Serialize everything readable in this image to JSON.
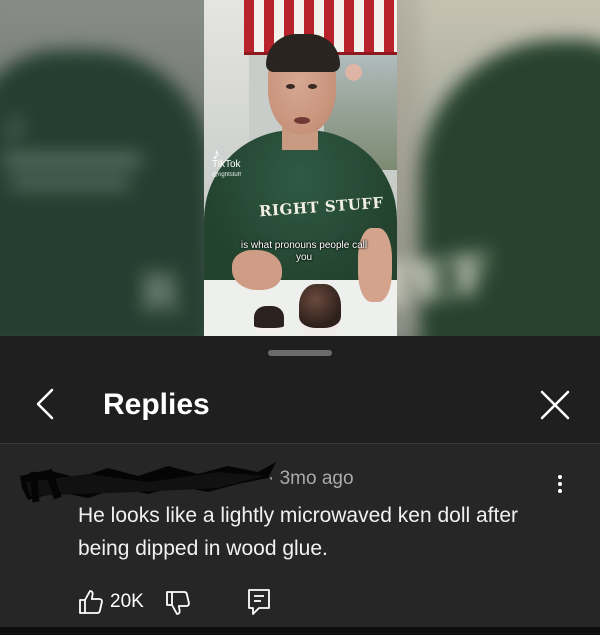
{
  "video": {
    "caption": "is what pronouns people call you",
    "sweater_text": "RIGHT STUFF",
    "watermark": "TikTok",
    "watermark_handle": "@rightstuff"
  },
  "sheet": {
    "title": "Replies",
    "back_icon": "chevron-left-icon",
    "close_icon": "close-icon"
  },
  "comment": {
    "timestamp": "· 3mo ago",
    "text": "He looks like a lightly microwaved ken doll after being dipped in wood glue.",
    "likes": "20K",
    "icons": {
      "like": "thumbs-up-icon",
      "dislike": "thumbs-down-icon",
      "reply": "reply-icon",
      "more": "more-vertical-icon"
    }
  },
  "colors": {
    "sheet_bg": "#1f1f1f",
    "comment_bg": "#262626",
    "meta_text": "#aaaaaa"
  }
}
